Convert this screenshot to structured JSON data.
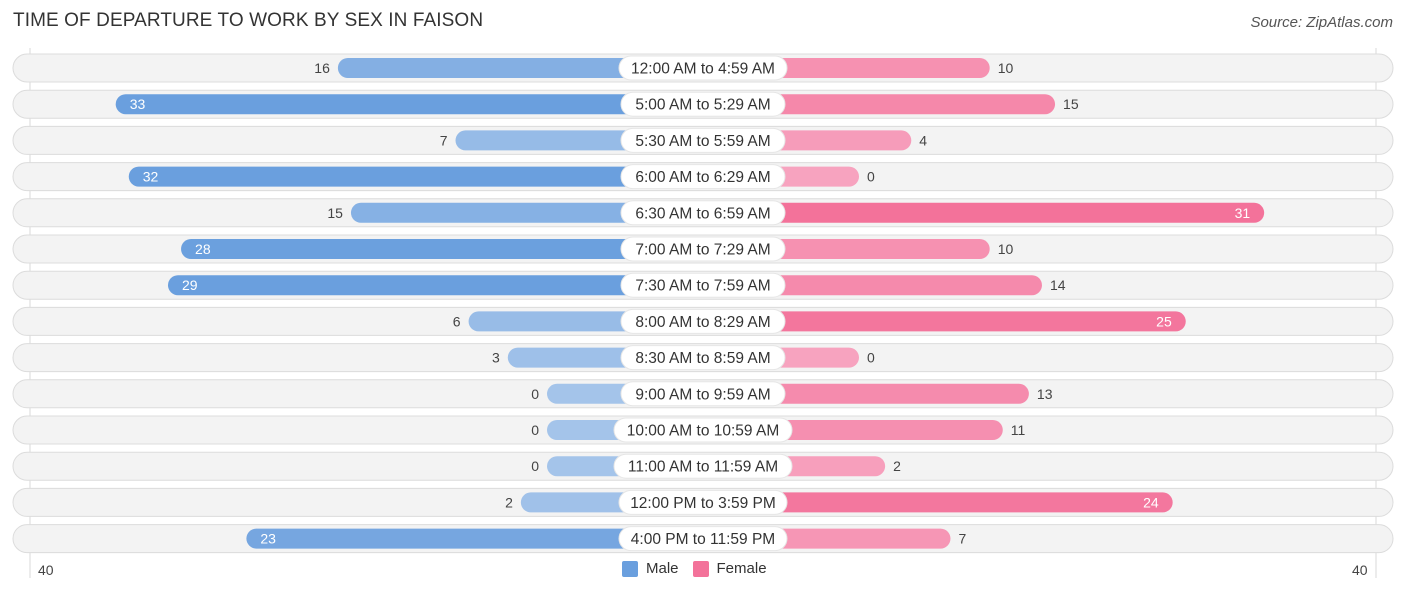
{
  "header": {
    "title": "TIME OF DEPARTURE TO WORK BY SEX IN FAISON",
    "source": "Source: ZipAtlas.com"
  },
  "axis": {
    "left_label": "40",
    "right_label": "40"
  },
  "legend": [
    {
      "label": "Male",
      "color": "#6a9fde"
    },
    {
      "label": "Female",
      "color": "#f3729a"
    }
  ],
  "colors": {
    "male_strong": "#6a9fde",
    "male_light": "#a4c4ea",
    "female_strong": "#f3729a",
    "female_light": "#f7a3bf",
    "row_bg": "#f3f3f3"
  },
  "chart_data": {
    "type": "bar",
    "orientation": "horizontal-diverging",
    "title": "TIME OF DEPARTURE TO WORK BY SEX IN FAISON",
    "xlabel": "",
    "ylabel": "",
    "xlim": [
      -40,
      40
    ],
    "categories": [
      "12:00 AM to 4:59 AM",
      "5:00 AM to 5:29 AM",
      "5:30 AM to 5:59 AM",
      "6:00 AM to 6:29 AM",
      "6:30 AM to 6:59 AM",
      "7:00 AM to 7:29 AM",
      "7:30 AM to 7:59 AM",
      "8:00 AM to 8:29 AM",
      "8:30 AM to 8:59 AM",
      "9:00 AM to 9:59 AM",
      "10:00 AM to 10:59 AM",
      "11:00 AM to 11:59 AM",
      "12:00 PM to 3:59 PM",
      "4:00 PM to 11:59 PM"
    ],
    "series": [
      {
        "name": "Male",
        "values": [
          16,
          33,
          7,
          32,
          15,
          28,
          29,
          6,
          3,
          0,
          0,
          0,
          2,
          23
        ]
      },
      {
        "name": "Female",
        "values": [
          10,
          15,
          4,
          0,
          31,
          10,
          14,
          25,
          0,
          13,
          11,
          2,
          24,
          7
        ]
      }
    ],
    "legend_position": "bottom-center",
    "grid": false
  }
}
